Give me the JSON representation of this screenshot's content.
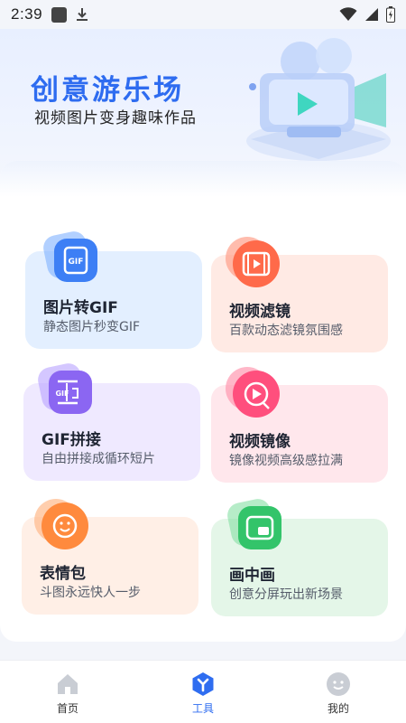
{
  "status_bar": {
    "time": "2:39"
  },
  "banner": {
    "title": "创意游乐场",
    "subtitle": "视频图片变身趣味作品"
  },
  "tools": [
    {
      "title": "图片转GIF",
      "desc": "静态图片秒变GIF",
      "bg": "#e3efff",
      "accent": "#3d7ff5",
      "icon": "gif-icon"
    },
    {
      "title": "视频滤镜",
      "desc": "百款动态滤镜氛围感",
      "bg": "#ffeae4",
      "accent": "#ff6a4a",
      "icon": "film-filter-icon"
    },
    {
      "title": "GIF拼接",
      "desc": "自由拼接成循环短片",
      "bg": "#efe9ff",
      "accent": "#8b66f2",
      "icon": "gif-splice-icon"
    },
    {
      "title": "视频镜像",
      "desc": "镜像视频高级感拉满",
      "bg": "#ffe7ec",
      "accent": "#ff4f7d",
      "icon": "video-mirror-icon"
    },
    {
      "title": "表情包",
      "desc": "斗图永远快人一步",
      "bg": "#ffefe6",
      "accent": "#ff8a3d",
      "icon": "smiley-icon"
    },
    {
      "title": "画中画",
      "desc": "创意分屏玩出新场景",
      "bg": "#e4f6e8",
      "accent": "#33c46a",
      "icon": "picture-in-picture-icon"
    }
  ],
  "nav": {
    "items": [
      {
        "label": "首页",
        "icon": "home-icon"
      },
      {
        "label": "工具",
        "icon": "tools-icon",
        "active": true
      },
      {
        "label": "我的",
        "icon": "profile-icon"
      }
    ],
    "active_color": "#2f6df0"
  }
}
